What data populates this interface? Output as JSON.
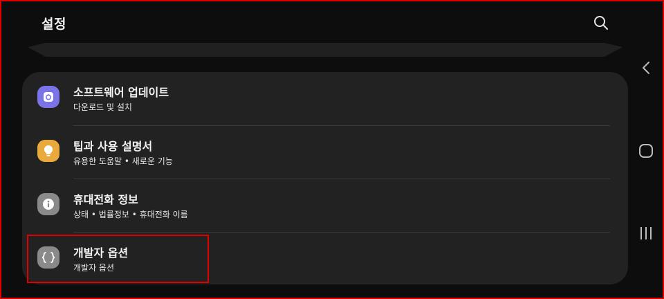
{
  "header": {
    "title": "설정"
  },
  "settings": [
    {
      "label": "소프트웨어 업데이트",
      "subtitle": "다운로드 및 설치",
      "icon": "software-update-icon",
      "icon_color": "#7a74e8"
    },
    {
      "label": "팁과 사용 설명서",
      "subtitle": "유용한 도움말 • 새로운 기능",
      "icon": "lightbulb-icon",
      "icon_color": "#e9a93c"
    },
    {
      "label": "휴대전화 정보",
      "subtitle": "상태 • 법률정보 • 휴대전화 이름",
      "icon": "info-icon",
      "icon_color": "#8a8a8a"
    },
    {
      "label": "개발자 옵션",
      "subtitle": "개발자 옵션",
      "icon": "developer-braces-icon",
      "icon_color": "#8a8a8a"
    }
  ],
  "nav": {
    "back": "back-icon",
    "home": "home-icon",
    "recents": "recents-icon"
  },
  "colors": {
    "background": "#0d0d0d",
    "card": "#222222",
    "highlight": "#e00000"
  }
}
